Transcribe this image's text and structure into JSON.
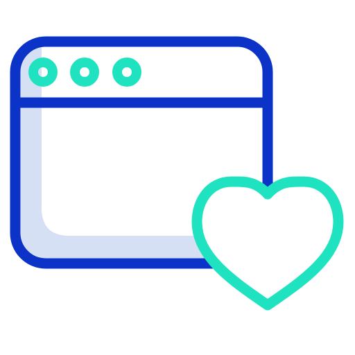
{
  "icon": {
    "name": "favorite-webpage-icon",
    "parts": {
      "window": "browser-window-icon",
      "dots": "window-control-dots-icon",
      "heart": "heart-icon"
    }
  },
  "colors": {
    "window_outline": "#0b33c7",
    "window_fill_shadow": "#d5e0f5",
    "accent": "#1fe3c0",
    "background": "#ffffff"
  }
}
